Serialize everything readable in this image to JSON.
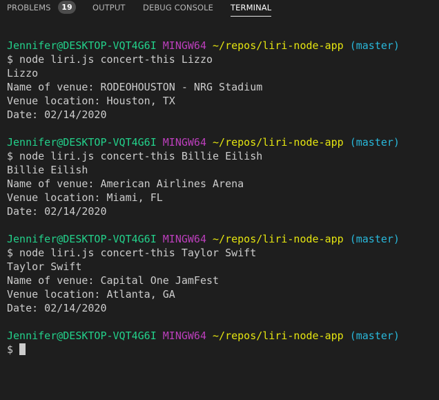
{
  "tabs": {
    "problems_label": "PROBLEMS",
    "problems_count": "19",
    "output_label": "OUTPUT",
    "debug_label": "DEBUG CONSOLE",
    "terminal_label": "TERMINAL"
  },
  "colors": {
    "background": "#1e1e1e",
    "text": "#cccccc",
    "user": "#23d18b",
    "env": "#bc3fbc",
    "path": "#e5e510",
    "branch": "#29b8db"
  },
  "terminal": {
    "prompt_user": "Jennifer@DESKTOP-VQT4G6I",
    "prompt_env": "MINGW64",
    "prompt_path": "~/repos/liri-node-app",
    "prompt_branch": "(master)",
    "prompt_symbol": "$",
    "blocks": [
      {
        "command": "$ node liri.js concert-this Lizzo",
        "artist": "Lizzo",
        "venue": "Name of venue: RODEOHOUSTON - NRG Stadium",
        "location": "Venue location: Houston, TX",
        "date": "Date: 02/14/2020"
      },
      {
        "command": "$ node liri.js concert-this Billie Eilish",
        "artist": "Billie Eilish",
        "venue": "Name of venue: American Airlines Arena",
        "location": "Venue location: Miami, FL",
        "date": "Date: 02/14/2020"
      },
      {
        "command": "$ node liri.js concert-this Taylor Swift",
        "artist": "Taylor Swift",
        "venue": "Name of venue: Capital One JamFest",
        "location": "Venue location: Atlanta, GA",
        "date": "Date: 02/14/2020"
      }
    ]
  }
}
